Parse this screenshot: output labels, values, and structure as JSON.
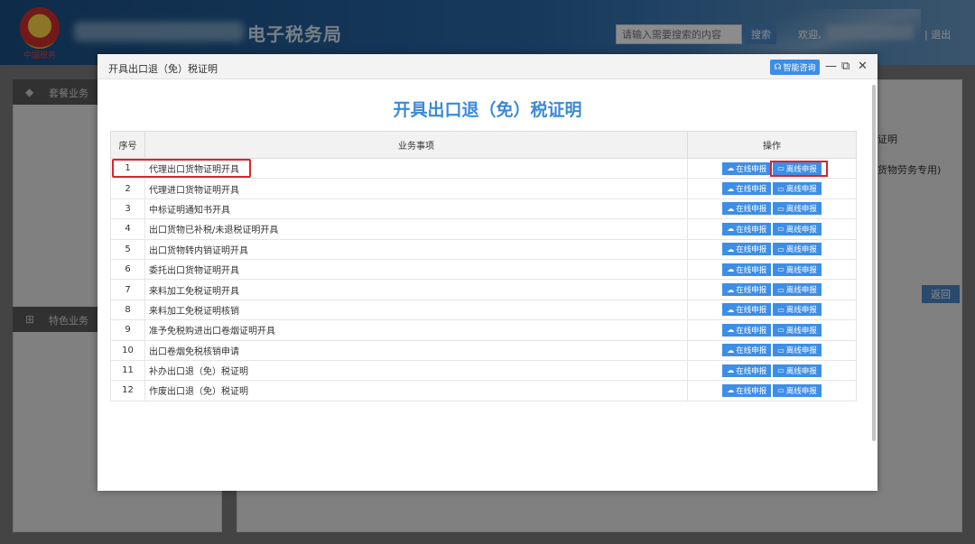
{
  "header": {
    "site_title": "电子税务局",
    "slogan": "中国税务",
    "search_placeholder": "请输入需要搜索的内容",
    "search_label": "搜索",
    "welcome": "欢迎,",
    "logout": "| 退出"
  },
  "background": {
    "panel1_title": "套餐业务",
    "panel2_title": "特色业务",
    "snippet1": "证明",
    "snippet2": "货物劳务专用)",
    "return_label": "返回"
  },
  "modal": {
    "window_title": "开具出口退（免）税证明",
    "consult_label": "智能咨询",
    "heading": "开具出口退（免）税证明",
    "columns": [
      "序号",
      "业务事项",
      "操作"
    ],
    "online_label": "在线申报",
    "offline_label": "离线申报",
    "rows": [
      {
        "no": "1",
        "name": "代理出口货物证明开具"
      },
      {
        "no": "2",
        "name": "代理进口货物证明开具"
      },
      {
        "no": "3",
        "name": "中标证明通知书开具"
      },
      {
        "no": "4",
        "name": "出口货物已补税/未退税证明开具"
      },
      {
        "no": "5",
        "name": "出口货物转内销证明开具"
      },
      {
        "no": "6",
        "name": "委托出口货物证明开具"
      },
      {
        "no": "7",
        "name": "来料加工免税证明开具"
      },
      {
        "no": "8",
        "name": "来料加工免税证明核销"
      },
      {
        "no": "9",
        "name": "准予免税购进出口卷烟证明开具"
      },
      {
        "no": "10",
        "name": "出口卷烟免税核销申请"
      },
      {
        "no": "11",
        "name": "补办出口退（免）税证明"
      },
      {
        "no": "12",
        "name": "作废出口退（免）税证明"
      }
    ]
  },
  "colors": {
    "accent": "#3d8ee6",
    "highlight": "#d7262e",
    "heading": "#3a8ad8"
  }
}
